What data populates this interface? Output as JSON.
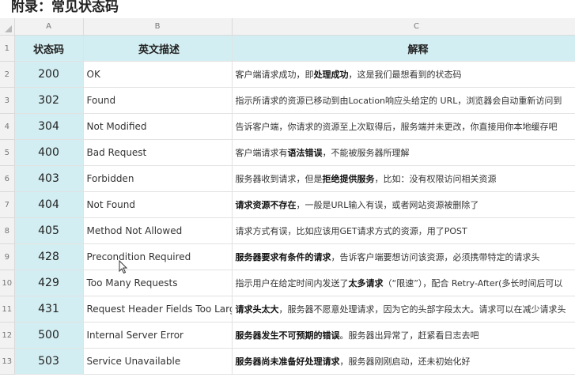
{
  "title": "附录：常见状态码",
  "columns": {
    "corner": "",
    "a": "A",
    "b": "B",
    "c": "C"
  },
  "header_row": {
    "num": "1",
    "code": "状态码",
    "english": "英文描述",
    "explain": "解释"
  },
  "rows": [
    {
      "num": "2",
      "code": "200",
      "english": "OK",
      "parts": [
        [
          "客户端请求成功，即",
          false
        ],
        [
          "处理成功",
          true
        ],
        [
          "，这是我们最想看到的状态码",
          false
        ]
      ]
    },
    {
      "num": "3",
      "code": "302",
      "english": "Found",
      "parts": [
        [
          "指示所请求的资源已移动到由Location响应头给定的 URL，浏览器会自动重新访问到",
          false
        ]
      ]
    },
    {
      "num": "4",
      "code": "304",
      "english": "Not Modified",
      "parts": [
        [
          "告诉客户端，你请求的资源至上次取得后，服务端并未更改，你直接用你本地缓存吧",
          false
        ]
      ]
    },
    {
      "num": "5",
      "code": "400",
      "english": "Bad Request",
      "parts": [
        [
          "客户端请求有",
          false
        ],
        [
          "语法错误",
          true
        ],
        [
          "，不能被服务器所理解",
          false
        ]
      ]
    },
    {
      "num": "6",
      "code": "403",
      "english": "Forbidden",
      "parts": [
        [
          "服务器收到请求，但是",
          false
        ],
        [
          "拒绝提供服务",
          true
        ],
        [
          "，比如：没有权限访问相关资源",
          false
        ]
      ]
    },
    {
      "num": "7",
      "code": "404",
      "english": "Not Found",
      "parts": [
        [
          "请求资源不存在",
          true
        ],
        [
          "，一般是URL输入有误，或者网站资源被删除了",
          false
        ]
      ]
    },
    {
      "num": "8",
      "code": "405",
      "english": "Method Not Allowed",
      "parts": [
        [
          "请求方式有误，比如应该用GET请求方式的资源，用了POST",
          false
        ]
      ]
    },
    {
      "num": "9",
      "code": "428",
      "english": "Precondition Required",
      "parts": [
        [
          "服务器要求有条件的请求",
          true
        ],
        [
          "，告诉客户端要想访问该资源，必须携带特定的请求头",
          false
        ]
      ]
    },
    {
      "num": "10",
      "code": "429",
      "english": "Too Many Requests",
      "parts": [
        [
          "指示用户在给定时间内发送了",
          false
        ],
        [
          "太多请求",
          true
        ],
        [
          "（“限速”），配合 Retry-After(多长时间后可以",
          false
        ]
      ]
    },
    {
      "num": "11",
      "code": "431",
      "english": "Request Header Fields Too Large",
      "parts": [
        [
          "请求头太大",
          true
        ],
        [
          "，服务器不愿意处理请求，因为它的头部字段太大。请求可以在减少请求头",
          false
        ]
      ]
    },
    {
      "num": "12",
      "code": "500",
      "english": "Internal Server Error",
      "parts": [
        [
          "服务器发生不可预期的错误",
          true
        ],
        [
          "。服务器出异常了，赶紧看日志去吧",
          false
        ]
      ]
    },
    {
      "num": "13",
      "code": "503",
      "english": "Service Unavailable",
      "parts": [
        [
          "服务器尚未准备好处理请求",
          true
        ],
        [
          "，服务器刚刚启动，还未初始化好",
          false
        ]
      ]
    }
  ]
}
